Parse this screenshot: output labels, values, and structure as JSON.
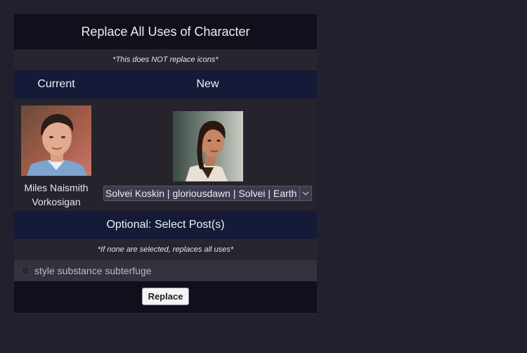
{
  "dialog": {
    "title": "Replace All Uses of Character",
    "note": "*This does NOT replace icons*"
  },
  "columns": {
    "current": "Current",
    "new": "New"
  },
  "current_character": {
    "name": "Miles Naismith Vorkosigan"
  },
  "new_character": {
    "selected": "Solvei Koskin | gloriousdawn | Solvei | Earth"
  },
  "posts": {
    "header": "Optional: Select Post(s)",
    "note": "*If none are selected, replaces all uses*",
    "items": [
      {
        "label": "style substance subterfuge",
        "checked": false
      }
    ]
  },
  "actions": {
    "replace_label": "Replace"
  },
  "colors": {
    "page_bg": "#231f2f",
    "header_bg": "#141a38",
    "title_bg": "#110f1c"
  }
}
